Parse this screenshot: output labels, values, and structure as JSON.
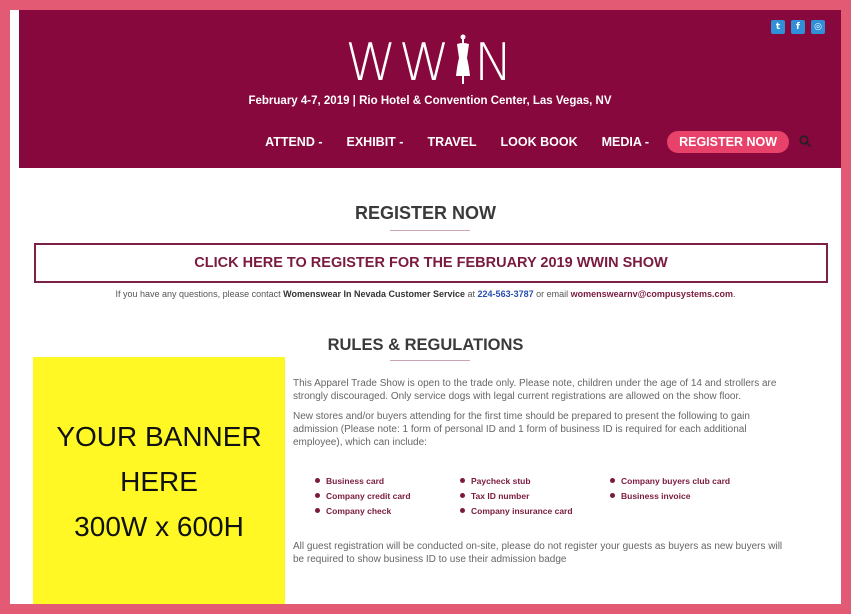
{
  "header": {
    "social_icons": [
      "twitter-icon",
      "facebook-icon",
      "instagram-icon"
    ],
    "logo_text_left": "WW",
    "logo_text_right": "N",
    "subtitle": "February 4-7, 2019 | Rio Hotel & Convention Center, Las Vegas, NV",
    "nav": [
      "ATTEND -",
      "EXHIBIT -",
      "TRAVEL",
      "LOOK BOOK",
      "MEDIA -"
    ],
    "register_button": "REGISTER NOW",
    "search_icon": "search-icon"
  },
  "main": {
    "register_title": "REGISTER NOW",
    "cta_text": "CLICK HERE TO REGISTER FOR THE FEBRUARY 2019 WWIN SHOW",
    "contact_prefix": "If you have any questions, please contact ",
    "contact_name": "Womenswear In Nevada Customer Service",
    "contact_mid": " at ",
    "contact_phone": "224-563-3787",
    "contact_or": " or email ",
    "contact_email": "womenswearnv@compusystems.com",
    "contact_end": ".",
    "rules_title": "RULES & REGULATIONS",
    "para1": "This Apparel Trade Show is open to the trade only. Please note, children under the age of 14 and strollers are strongly discouraged. Only service dogs with legal current registrations are allowed on the show floor.",
    "para2": "New stores and/or buyers attending for the first time should be prepared to present the following to gain admission (Please note: 1 form of personal ID and 1 form of business ID is required for each additional employee), which can include:",
    "id_items": [
      "Business card",
      "Paycheck stub",
      "Company buyers club card",
      "Company credit card",
      "Tax ID number",
      "Business invoice",
      "Company check",
      "Company insurance card"
    ],
    "para3": "All guest registration will be conducted on-site, please do not register your guests as buyers as new buyers will be required to show business ID to use their admission badge"
  },
  "banner": {
    "line1": "YOUR BANNER",
    "line2": "HERE",
    "line3": "300W x 600H"
  },
  "colors": {
    "outer_border": "#e35a75",
    "header_bg": "#86083d",
    "accent": "#e8416a",
    "banner_bg": "#fff825"
  }
}
